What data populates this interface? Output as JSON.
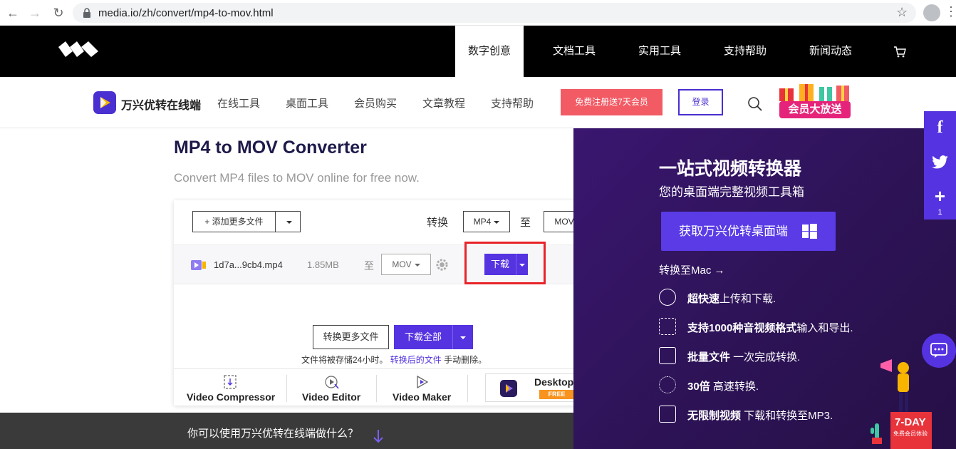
{
  "browser": {
    "url": "media.io/zh/convert/mp4-to-mov.html"
  },
  "topnav": {
    "items": [
      "数字创意",
      "文档工具",
      "实用工具",
      "支持帮助",
      "新闻动态"
    ],
    "active_index": 0
  },
  "subnav": {
    "brand": "万兴优转在线端",
    "items": [
      "在线工具",
      "桌面工具",
      "会员购买",
      "文章教程",
      "支持帮助"
    ],
    "register_label": "免费注册送7天会员",
    "login_label": "登录",
    "promo_label": "会员大放送"
  },
  "main": {
    "title": "MP4 to MOV Converter",
    "subtitle": "Convert MP4 files to MOV online for free now."
  },
  "converter": {
    "add_files_label": "+ 添加更多文件",
    "convert_label": "转换",
    "from_format": "MP4",
    "to_label": "至",
    "to_format": "MOV",
    "file": {
      "name": "1d7a...9cb4.mp4",
      "size": "1.85MB",
      "to_label": "至",
      "format": "MOV",
      "download_label": "下载"
    },
    "convert_more_label": "转换更多文件",
    "download_all_label": "下载全部",
    "notice_prefix": "文件将被存储24小时。",
    "notice_link": "转换后的文件",
    "notice_suffix": "手动删除。"
  },
  "tools": {
    "items": [
      "Video Compressor",
      "Video Editor",
      "Video Maker"
    ],
    "desktop_label": "Desktop",
    "desktop_badge": "FREE"
  },
  "darkbar": {
    "text": "你可以使用万兴优转在线端做什么？"
  },
  "promo_panel": {
    "title": "一站式视频转换器",
    "subtitle": "您的桌面端完整视频工具箱",
    "get_button": "获取万兴优转桌面端",
    "mac_link": "转换至Mac →",
    "features": [
      {
        "bold": "超快速",
        "rest": "上传和下载."
      },
      {
        "bold": "支持1000种音视频格式",
        "rest": "输入和导出."
      },
      {
        "bold": "批量文件",
        "rest": " 一次完成转换."
      },
      {
        "bold": "30倍",
        "rest": " 高速转换."
      },
      {
        "bold": "无限制视频",
        "rest": " 下载和转换至MP3."
      }
    ],
    "badge_label": "7-DAY",
    "badge_sub": "免费会员体验"
  },
  "social": {
    "share_count": "1"
  },
  "colors": {
    "accent": "#5533e0",
    "highlight": "#e8232a",
    "register": "#f25a64"
  }
}
